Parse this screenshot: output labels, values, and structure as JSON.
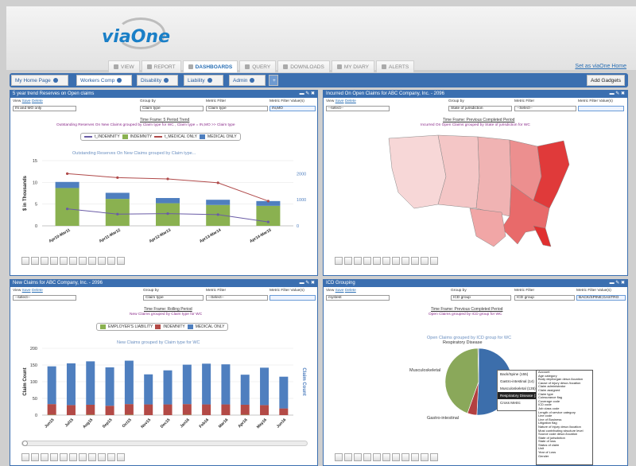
{
  "app": {
    "logo": "viaOne",
    "set_as_home": "Set as viaOne Home"
  },
  "top_nav": [
    {
      "label": "VIEW",
      "active": false
    },
    {
      "label": "REPORT",
      "active": false
    },
    {
      "label": "DASHBOARDS",
      "active": true
    },
    {
      "label": "QUERY",
      "active": false
    },
    {
      "label": "DOWNLOADS",
      "active": false
    },
    {
      "label": "MY DIARY",
      "active": false
    },
    {
      "label": "ALERTS",
      "active": false
    }
  ],
  "dash_tabs": [
    {
      "label": "My Home Page",
      "active": false
    },
    {
      "label": "Workers Comp",
      "active": true
    },
    {
      "label": "Disability",
      "active": false
    },
    {
      "label": "Liability",
      "active": false
    },
    {
      "label": "Admin",
      "active": false
    }
  ],
  "add_tab": "+",
  "add_gadgets": "Add Gadgets",
  "labels": {
    "view": "View",
    "save": "Save",
    "delete": "Delete",
    "group_by": "Group by",
    "metric_filter": "Metric Filter",
    "metric_filter_value": "Metric Filter Value(s)",
    "controls": "▬ ✎ ✖"
  },
  "panels": {
    "p1": {
      "title": "5 year trend Reserves on Open claims",
      "view": "IN and MO only",
      "group_by": "Claim type",
      "metric_filter": "Claim type",
      "metric_value": "IN,MO",
      "time_frame": "Time Frame: 5 Period Trend",
      "subtitle": "Outstanding Reserves On New Claims grouped by Claim type for WC , Claim type = IN,MO >> Claim type"
    },
    "p2": {
      "title": "Incurred On Open Claims for ABC Company, Inc. - 2096",
      "view": "--select--",
      "group_by": "State of jurisdiction",
      "metric_filter": "--Select--",
      "metric_value": "",
      "time_frame": "Time Frame: Previous Completed Period",
      "subtitle": "Incurred On Open Claims grouped by State of jurisdiction for WC"
    },
    "p3": {
      "title": "New Claims for ABC Company, Inc. - 2096",
      "view": "--select--",
      "group_by": "Claim type",
      "metric_filter": "--Select--",
      "metric_value": "",
      "time_frame": "Time Frame: Rolling Period",
      "subtitle": "New Claims grouped by Claim type for WC"
    },
    "p4": {
      "title": "ICD Grouping",
      "view": "mystest",
      "group_by": "ICD group",
      "metric_filter": "ICD group",
      "metric_value": "BACK/SPINE;GASTRO",
      "time_frame": "Time Frame: Previous Completed Period",
      "subtitle": "Open Claims grouped by ICD group for WC"
    }
  },
  "chart1": {
    "legend": [
      "t_INDEMNITY",
      "INDEMNITY",
      "t_MEDICAL ONLY",
      "MEDICAL ONLY"
    ],
    "title": "Outstanding Reserves On New Claims grouped by Claim type...",
    "ylabel": "$ in Thousands",
    "yticks": [
      "0",
      "5",
      "10",
      "15"
    ],
    "y2ticks": [
      "0",
      "1000",
      "2000"
    ],
    "xcats": [
      "Apr10-Mar11",
      "Apr11-Mar12",
      "Apr12-Mar13",
      "Apr13-Mar14",
      "Apr14-Mar15"
    ]
  },
  "chart3": {
    "legend": [
      "EMPLOYER'S LIABILITY",
      "INDEMNITY",
      "MEDICAL ONLY"
    ],
    "title": "New Claims grouped by Claim type for WC",
    "ylabel": "Claim Count",
    "y2label": "Claim Count",
    "yticks": [
      "0",
      "50",
      "100",
      "150",
      "200"
    ],
    "xcats": [
      "Jun15",
      "Jul15",
      "Aug15",
      "Sep15",
      "Oct15",
      "Nov15",
      "Dec15",
      "Jan16",
      "Feb16",
      "Mar16",
      "Apr16",
      "May16",
      "Jun16"
    ]
  },
  "chart4": {
    "title": "Open Claims grouped by ICD group for WC",
    "labels": [
      "Respiratory Disease",
      "Musculoskeletal",
      "Gastro-intestinal"
    ],
    "tooltip": [
      "Back/Spine (155)",
      "Gastro-intestinal (14)",
      "Musculoskeletal (135)",
      "Respiratory Disease (1)",
      "Cross Metric"
    ]
  },
  "dropdown_items": [
    "Account",
    "Age category",
    "Body dept/organ descr./location",
    "Cause of injury descr./location",
    "Claim administrator",
    "Claim assigned",
    "Claim type",
    "Coinsurance flag",
    "Coverage code",
    "ICD code",
    "Job class code",
    "Length of service category",
    "Line code",
    "Line of Business",
    "Litigation flag",
    "Nature of injury descr./location",
    "Most contributing structure level",
    "Source code descr./location",
    "State of jurisdiction",
    "State of loss",
    "Status of claim",
    "Unit",
    "Year of Loss",
    "Gender"
  ],
  "chart_data": [
    {
      "type": "bar",
      "title": "Outstanding Reserves On New Claims grouped by Claim type...",
      "ylabel": "$ in Thousands",
      "ylim": [
        0,
        15
      ],
      "y2lim": [
        0,
        2500
      ],
      "categories": [
        "Apr10-Mar11",
        "Apr11-Mar12",
        "Apr12-Mar13",
        "Apr13-Mar14",
        "Apr14-Mar15"
      ],
      "series": [
        {
          "name": "MEDICAL ONLY",
          "stack": "bar",
          "values": [
            8.7,
            6.2,
            5.2,
            4.8,
            4.6
          ]
        },
        {
          "name": "INDEMNITY",
          "stack": "bar",
          "values": [
            1.4,
            1.4,
            1.2,
            1.2,
            1.1
          ]
        },
        {
          "name": "t_INDEMNITY",
          "line": true,
          "axis": "y2",
          "values": [
            650,
            450,
            470,
            430,
            150
          ]
        },
        {
          "name": "t_MEDICAL ONLY",
          "line": true,
          "axis": "y2",
          "values": [
            2000,
            1850,
            1800,
            1650,
            950
          ]
        }
      ]
    },
    {
      "type": "bar",
      "title": "New Claims grouped by Claim type for WC",
      "ylabel": "Claim Count",
      "ylim": [
        0,
        200
      ],
      "categories": [
        "Jun15",
        "Jul15",
        "Aug15",
        "Sep15",
        "Oct15",
        "Nov15",
        "Dec15",
        "Jan16",
        "Feb16",
        "Mar16",
        "Apr16",
        "May16",
        "Jun16"
      ],
      "series": [
        {
          "name": "EMPLOYER'S LIABILITY",
          "values": [
            1,
            0,
            1,
            0,
            1,
            0,
            0,
            1,
            0,
            0,
            1,
            0,
            0
          ]
        },
        {
          "name": "INDEMNITY",
          "values": [
            32,
            30,
            30,
            28,
            32,
            32,
            32,
            32,
            32,
            32,
            30,
            30,
            20
          ]
        },
        {
          "name": "MEDICAL ONLY",
          "values": [
            113,
            125,
            130,
            115,
            130,
            90,
            102,
            118,
            122,
            120,
            90,
            112,
            95
          ]
        }
      ]
    },
    {
      "type": "pie",
      "title": "Open Claims grouped by ICD group for WC",
      "labels": [
        "Back/Spine",
        "Gastro-intestinal",
        "Musculoskeletal",
        "Respiratory Disease"
      ],
      "values": [
        155,
        14,
        135,
        1
      ],
      "colors": [
        "#3c6eab",
        "#b34040",
        "#8aa85a",
        "#333333"
      ]
    }
  ],
  "colors": {
    "medical": "#8ab150",
    "indemnity": "#4f7fbf",
    "indemnity_bar": "#b34a46",
    "employer": "#8ab150",
    "t_ind": "#6a5ca6",
    "t_med": "#b04a4a",
    "header_blue": "#3b6fb0"
  }
}
